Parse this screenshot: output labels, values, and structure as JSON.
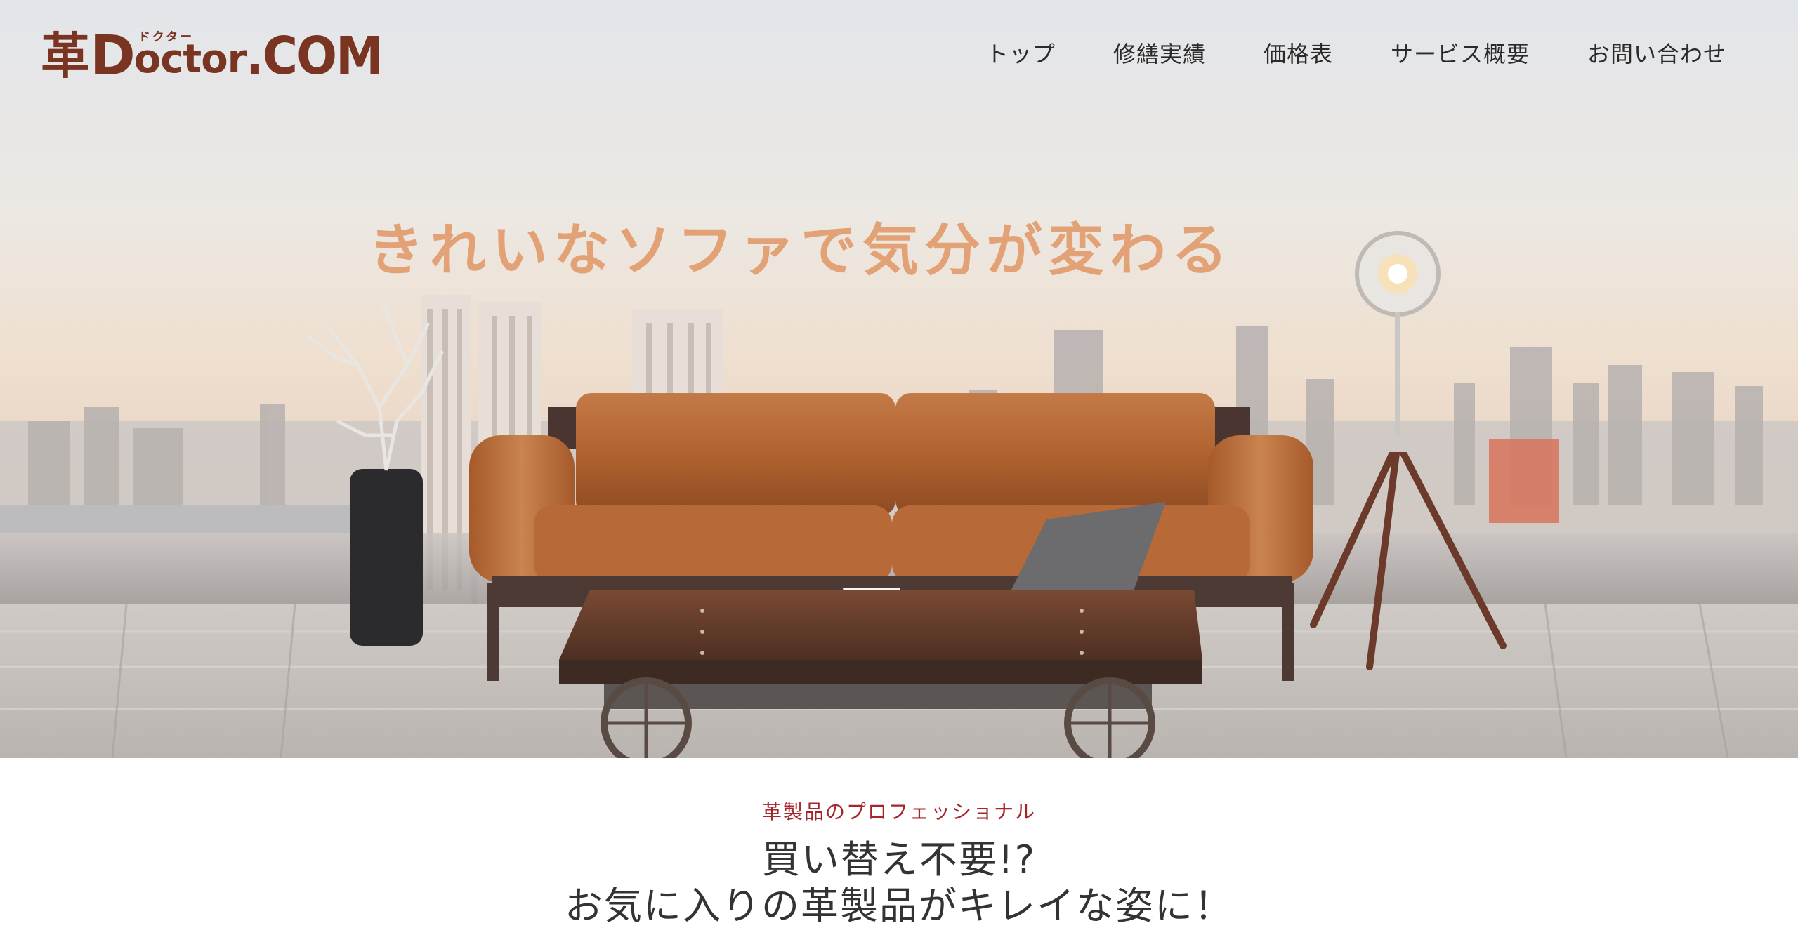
{
  "header": {
    "logo": {
      "kanji": "革",
      "d": "D",
      "ruby": "ドクター",
      "octor": "octor",
      "com": ".COM"
    },
    "nav": [
      {
        "label": "トップ"
      },
      {
        "label": "修繕実績"
      },
      {
        "label": "価格表"
      },
      {
        "label": "サービス概要"
      },
      {
        "label": "お問い合わせ"
      }
    ]
  },
  "hero": {
    "headline": "きれいなソファで気分が変わる",
    "image_icon": "living-room-photo"
  },
  "intro": {
    "label": "革製品のプロフェッショナル",
    "heading_line1": "買い替え不要!?",
    "heading_line2": "お気に入りの革製品がキレイな姿に！"
  },
  "colors": {
    "brand": "#7a3522",
    "headline": "#e3a176",
    "accent_label": "#a4262c",
    "nav_text": "#2b2b2b",
    "heading_text": "#333333"
  }
}
